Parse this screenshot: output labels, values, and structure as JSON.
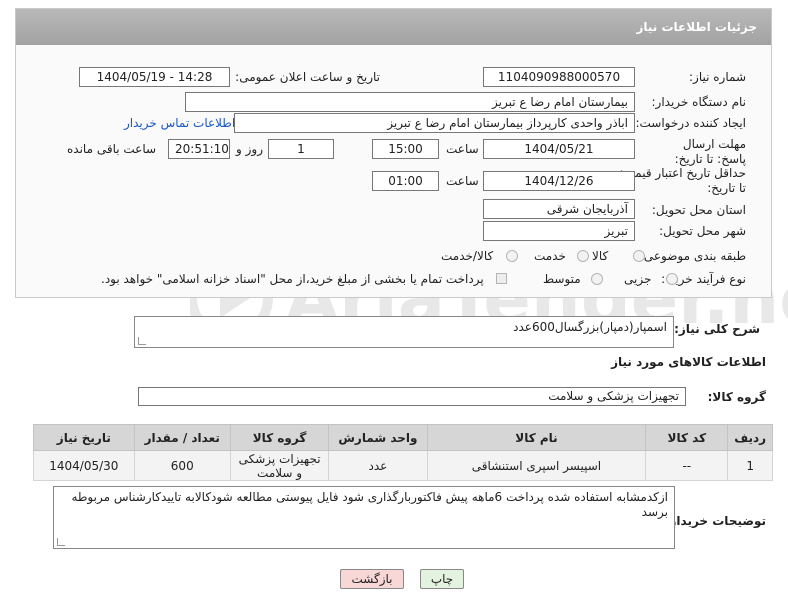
{
  "header": {
    "title": "جزئیات اطلاعات نیاز"
  },
  "fields": {
    "need_number": {
      "label": "شماره نیاز:",
      "value": "1104090988000570"
    },
    "announce_datetime": {
      "label": "تاریخ و ساعت اعلان عمومی:",
      "value": "1404/05/19 - 14:28"
    },
    "buyer_org": {
      "label": "نام دستگاه خریدار:",
      "value": "بیمارستان امام رضا  ع  تبریز"
    },
    "requester": {
      "label": "ایجاد کننده درخواست:",
      "value": "اباذر واحدی کارپرداز بیمارستان امام رضا  ع  تبریز",
      "contact_link": "اطلاعات تماس خریدار"
    },
    "deadline": {
      "label": "مهلت ارسال پاسخ: تا تاریخ:",
      "date": "1404/05/21",
      "time_label": "ساعت",
      "time": "15:00",
      "days": "1",
      "days_label": "روز و",
      "remaining": "20:51:10",
      "remaining_label": "ساعت باقی مانده"
    },
    "price_validity": {
      "label": "حداقل تاریخ اعتبار قیمت: تا تاریخ:",
      "date": "1404/12/26",
      "time_label": "ساعت",
      "time": "01:00"
    },
    "delivery_province": {
      "label": "استان محل تحویل:",
      "value": "آذربایجان شرقی"
    },
    "delivery_city": {
      "label": "شهر محل تحویل:",
      "value": "تبریز"
    },
    "category": {
      "label": "طبقه بندی موضوعی:",
      "options": [
        "کالا",
        "خدمت",
        "کالا/خدمت"
      ],
      "selected": "کالا"
    },
    "process_type": {
      "label": "نوع فرآیند خرید :",
      "options": [
        "جزیی",
        "متوسط"
      ],
      "note": "پرداخت تمام یا بخشی از مبلغ خرید،از محل \"اسناد خزانه اسلامی\" خواهد بود."
    }
  },
  "description": {
    "label": "شرح کلی نیاز:",
    "value": "اسمپار(دمپار)بزرگسال600عدد"
  },
  "goods_section": {
    "title": "اطلاعات کالاهای مورد نیاز"
  },
  "goods_group": {
    "label": "گروه کالا:",
    "value": "تجهیزات پزشکی و سلامت"
  },
  "table": {
    "headers": [
      "ردیف",
      "کد کالا",
      "نام کالا",
      "واحد شمارش",
      "گروه کالا",
      "تعداد / مقدار",
      "تاریخ نیاز"
    ],
    "rows": [
      [
        "1",
        "--",
        "اسپیسر اسپری استنشاقی",
        "عدد",
        "تجهیزات پزشکی و سلامت",
        "600",
        "1404/05/30"
      ]
    ]
  },
  "buyer_notes": {
    "label": "توضیحات خریدار:",
    "value": "ازکدمشابه استفاده شده پرداخت 6ماهه پیش فاکتوربارگذاری شود فایل پیوستی مطالعه شودکالابه تاییدکارشناس مربوطه برسد"
  },
  "buttons": {
    "print": "چاپ",
    "back": "بازگشت"
  },
  "colors": {
    "header_bg": "#a8a8a8",
    "link": "#1a56c4",
    "back_btn_bg": "#f8d7d7",
    "print_btn_bg": "#e4f3df"
  }
}
